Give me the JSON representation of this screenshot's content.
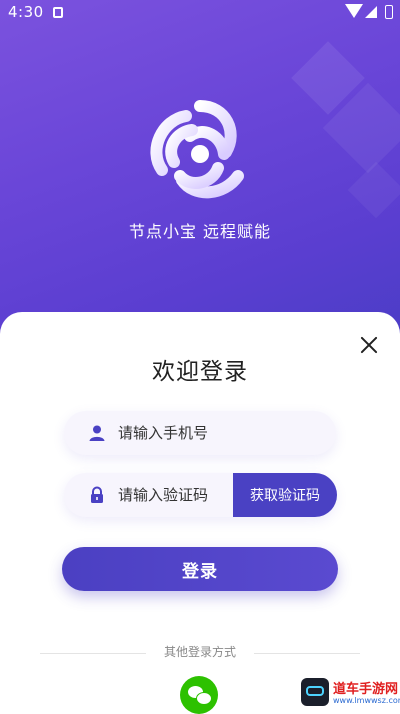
{
  "status_bar": {
    "time": "4:30"
  },
  "hero": {
    "slogan": "节点小宝 远程赋能"
  },
  "sheet": {
    "title": "欢迎登录",
    "phone_placeholder": "请输入手机号",
    "code_placeholder": "请输入验证码",
    "get_code_label": "获取验证码",
    "login_label": "登录",
    "other_login_label": "其他登录方式"
  },
  "watermark": {
    "text": "道车手游网",
    "url": "www.lmwwsz.com"
  },
  "colors": {
    "primary": "#4a41c3",
    "gradient_top": "#7b52de",
    "wechat": "#2dc100"
  }
}
